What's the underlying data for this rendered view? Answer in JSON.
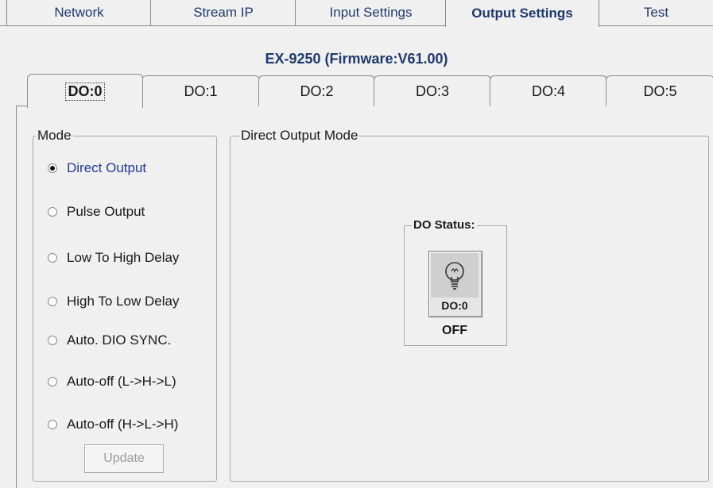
{
  "top_tabs": [
    {
      "label": "Network"
    },
    {
      "label": "Stream IP"
    },
    {
      "label": "Input Settings"
    },
    {
      "label": "Output Settings",
      "active": true
    },
    {
      "label": "Test"
    }
  ],
  "device_title": "EX-9250 (Firmware:V61.00)",
  "do_tabs": [
    {
      "label": "DO:0",
      "active": true
    },
    {
      "label": "DO:1"
    },
    {
      "label": "DO:2"
    },
    {
      "label": "DO:3"
    },
    {
      "label": "DO:4"
    },
    {
      "label": "DO:5"
    }
  ],
  "mode": {
    "legend": "Mode",
    "options": [
      {
        "label": "Direct Output",
        "selected": true
      },
      {
        "label": "Pulse Output"
      },
      {
        "label": "Low To High Delay"
      },
      {
        "label": "High To Low Delay"
      },
      {
        "label": "Auto. DIO SYNC."
      },
      {
        "label": "Auto-off (L->H->L)"
      },
      {
        "label": "Auto-off (H->L->H)"
      }
    ],
    "update_label": "Update"
  },
  "direct_output": {
    "legend": "Direct Output Mode",
    "status_legend": "DO Status:",
    "channel_label": "DO:0",
    "state": "OFF",
    "icon": "light-bulb-icon"
  },
  "colors": {
    "background": "#f0f0f0",
    "title": "#1f3a6e",
    "selected_option": "#1f3a9e"
  }
}
